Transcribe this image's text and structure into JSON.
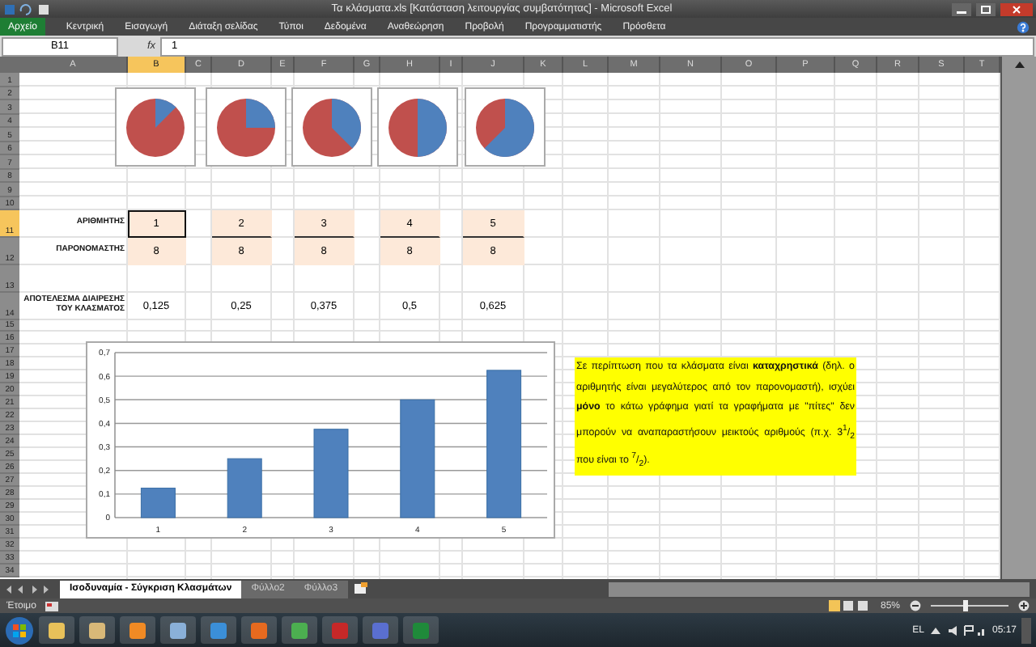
{
  "window": {
    "title": "Τα κλάσματα.xls  [Κατάσταση λειτουργίας συμβατότητας]  -  Microsoft Excel"
  },
  "ribbon_tabs": [
    {
      "label": "Αρχείο",
      "kind": "file"
    },
    {
      "label": "Κεντρική",
      "kind": "tab"
    },
    {
      "label": "Εισαγωγή",
      "kind": "tab"
    },
    {
      "label": "Διάταξη σελίδας",
      "kind": "tab"
    },
    {
      "label": "Τύποι",
      "kind": "tab"
    },
    {
      "label": "Δεδομένα",
      "kind": "tab"
    },
    {
      "label": "Αναθεώρηση",
      "kind": "tab"
    },
    {
      "label": "Προβολή",
      "kind": "tab"
    },
    {
      "label": "Προγραμματιστής",
      "kind": "tab"
    },
    {
      "label": "Πρόσθετα",
      "kind": "tab"
    }
  ],
  "formula_bar": {
    "name_box": "B11",
    "fx": "fx",
    "value": "1"
  },
  "columns": [
    {
      "label": "A",
      "selected": false
    },
    {
      "label": "B",
      "selected": true
    },
    {
      "label": "C",
      "selected": false
    },
    {
      "label": "D",
      "selected": false
    },
    {
      "label": "E",
      "selected": false
    },
    {
      "label": "F",
      "selected": false
    },
    {
      "label": "G",
      "selected": false
    },
    {
      "label": "H",
      "selected": false
    },
    {
      "label": "I",
      "selected": false
    },
    {
      "label": "J",
      "selected": false
    },
    {
      "label": "K",
      "selected": false
    },
    {
      "label": "L",
      "selected": false
    },
    {
      "label": "M",
      "selected": false
    },
    {
      "label": "N",
      "selected": false
    },
    {
      "label": "O",
      "selected": false
    },
    {
      "label": "P",
      "selected": false
    },
    {
      "label": "Q",
      "selected": false
    },
    {
      "label": "R",
      "selected": false
    },
    {
      "label": "S",
      "selected": false
    },
    {
      "label": "T",
      "selected": false
    }
  ],
  "rows": [
    {
      "label": "1",
      "selected": false
    },
    {
      "label": "2",
      "selected": false
    },
    {
      "label": "3",
      "selected": false
    },
    {
      "label": "4",
      "selected": false
    },
    {
      "label": "5",
      "selected": false
    },
    {
      "label": "6",
      "selected": false
    },
    {
      "label": "7",
      "selected": false
    },
    {
      "label": "8",
      "selected": false
    },
    {
      "label": "9",
      "selected": false
    },
    {
      "label": "10",
      "selected": false
    },
    {
      "label": "11",
      "selected": true
    },
    {
      "label": "12",
      "selected": false
    },
    {
      "label": "13",
      "selected": false
    },
    {
      "label": "14",
      "selected": false
    },
    {
      "label": "15",
      "selected": false
    },
    {
      "label": "16",
      "selected": false
    },
    {
      "label": "17",
      "selected": false
    },
    {
      "label": "18",
      "selected": false
    },
    {
      "label": "19",
      "selected": false
    },
    {
      "label": "20",
      "selected": false
    },
    {
      "label": "21",
      "selected": false
    },
    {
      "label": "22",
      "selected": false
    },
    {
      "label": "23",
      "selected": false
    },
    {
      "label": "24",
      "selected": false
    },
    {
      "label": "25",
      "selected": false
    },
    {
      "label": "26",
      "selected": false
    },
    {
      "label": "27",
      "selected": false
    },
    {
      "label": "28",
      "selected": false
    },
    {
      "label": "29",
      "selected": false
    },
    {
      "label": "30",
      "selected": false
    },
    {
      "label": "31",
      "selected": false
    },
    {
      "label": "32",
      "selected": false
    },
    {
      "label": "33",
      "selected": false
    },
    {
      "label": "34",
      "selected": false
    }
  ],
  "labels": {
    "numerator": "ΑΡΙΘΜΗΤΗΣ",
    "denominator": "ΠΑΡΟΝΟΜΑΣΤΗΣ",
    "result": "ΑΠΟΤΕΛΕΣΜΑ ΔΙΑΙΡΕΣΗΣ ΤΟΥ ΚΛΑΣΜΑΤΟΣ"
  },
  "fractions": [
    {
      "numerator": "1",
      "denominator": "8",
      "result": "0,125",
      "selected": true
    },
    {
      "numerator": "2",
      "denominator": "8",
      "result": "0,25",
      "selected": false
    },
    {
      "numerator": "3",
      "denominator": "8",
      "result": "0,375",
      "selected": false
    },
    {
      "numerator": "4",
      "denominator": "8",
      "result": "0,5",
      "selected": false
    },
    {
      "numerator": "5",
      "denominator": "8",
      "result": "0,625",
      "selected": false
    }
  ],
  "bar_chart": {
    "chart_data": {
      "type": "bar",
      "categories": [
        "1",
        "2",
        "3",
        "4",
        "5"
      ],
      "grid": true,
      "series": [
        {
          "color": "#4f81bd",
          "values": [
            0.125,
            0.25,
            0.375,
            0.5,
            0.625
          ]
        }
      ],
      "ylim": [
        0,
        0.7
      ],
      "yticks": [
        {
          "value": 0,
          "label": "0"
        },
        {
          "value": 0.1,
          "label": "0,1"
        },
        {
          "value": 0.2,
          "label": "0,2"
        },
        {
          "value": 0.3,
          "label": "0,3"
        },
        {
          "value": 0.4,
          "label": "0,4"
        },
        {
          "value": 0.5,
          "label": "0,5"
        },
        {
          "value": 0.6,
          "label": "0,6"
        },
        {
          "value": 0.7,
          "label": "0,7"
        }
      ]
    }
  },
  "note": "Σε περίπτωση που τα κλάσματα είναι **καταχρηστικά** (δηλ. ο αριθμητής είναι μεγαλύτερος από τον παρονομαστή), ισχύει **μόνο** το κάτω γράφημα γιατί τα γραφήματα με \"πίτες\" δεν μπορούν να αναπαραστήσουν μεικτούς αριθμούς (π.χ. 3$^{1}$/$_{2}$ που είναι το $^{7}$/$_{2}$).",
  "sheet_tabs": [
    {
      "label": "Ισοδυναμία - Σύγκριση Κλασμάτων",
      "selected": true
    },
    {
      "label": "Φύλλο2",
      "selected": false
    },
    {
      "label": "Φύλλο3",
      "selected": false
    }
  ],
  "status_bar": {
    "text": "Έτοιμο",
    "zoom": "85%",
    "zoom_slider": {
      "level": 0.44
    }
  },
  "taskbar": {
    "language": "EL",
    "time": "05:17"
  }
}
